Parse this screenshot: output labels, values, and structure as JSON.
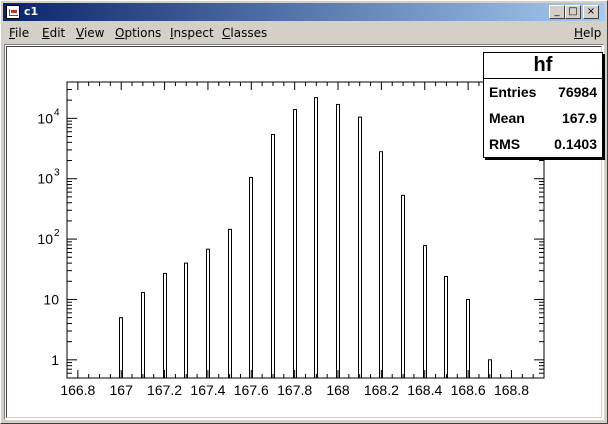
{
  "window": {
    "title": "c1",
    "buttons": {
      "minimize": "_",
      "maximize": "□",
      "close": "×"
    }
  },
  "menu": {
    "items": [
      {
        "label": "File",
        "accel": "F",
        "rest": "ile"
      },
      {
        "label": "Edit",
        "accel": "E",
        "rest": "dit"
      },
      {
        "label": "View",
        "accel": "V",
        "rest": "iew"
      },
      {
        "label": "Options",
        "accel": "O",
        "rest": "ptions"
      },
      {
        "label": "Inspect",
        "accel": "I",
        "rest": "nspect"
      },
      {
        "label": "Classes",
        "accel": "C",
        "rest": "lasses"
      }
    ],
    "help": {
      "label": "Help",
      "accel": "H",
      "rest": "elp"
    }
  },
  "stats": {
    "title": "hf",
    "rows": [
      {
        "label": "Entries",
        "value": "76984"
      },
      {
        "label": "Mean",
        "value": "167.9"
      },
      {
        "label": "RMS",
        "value": "0.1403"
      }
    ]
  },
  "chart_data": {
    "type": "bar",
    "title": "",
    "xlabel": "",
    "ylabel": "",
    "y_scale": "log",
    "ylim": [
      0.5,
      40000
    ],
    "xlim": [
      166.75,
      168.95
    ],
    "x_ticks": [
      "166.8",
      "167",
      "167.2",
      "167.4",
      "167.6",
      "167.8",
      "168",
      "168.2",
      "168.4",
      "168.6",
      "168.8"
    ],
    "x_tick_values": [
      166.8,
      167.0,
      167.2,
      167.4,
      167.6,
      167.8,
      168.0,
      168.2,
      168.4,
      168.6,
      168.8
    ],
    "y_ticks": [
      {
        "value": 1,
        "base": "1",
        "exp": ""
      },
      {
        "value": 10,
        "base": "10",
        "exp": ""
      },
      {
        "value": 100,
        "base": "10",
        "exp": "2"
      },
      {
        "value": 1000,
        "base": "10",
        "exp": "3"
      },
      {
        "value": 10000,
        "base": "10",
        "exp": "4"
      }
    ],
    "x": [
      167.0,
      167.1,
      167.2,
      167.3,
      167.4,
      167.5,
      167.6,
      167.7,
      167.8,
      167.9,
      168.0,
      168.1,
      168.2,
      168.3,
      168.4,
      168.5,
      168.6,
      168.7
    ],
    "values": [
      5,
      13,
      27,
      40,
      68,
      145,
      1050,
      5400,
      14000,
      22000,
      17000,
      10500,
      2800,
      530,
      78,
      24,
      10,
      1
    ],
    "grid": false,
    "legend": "none"
  }
}
